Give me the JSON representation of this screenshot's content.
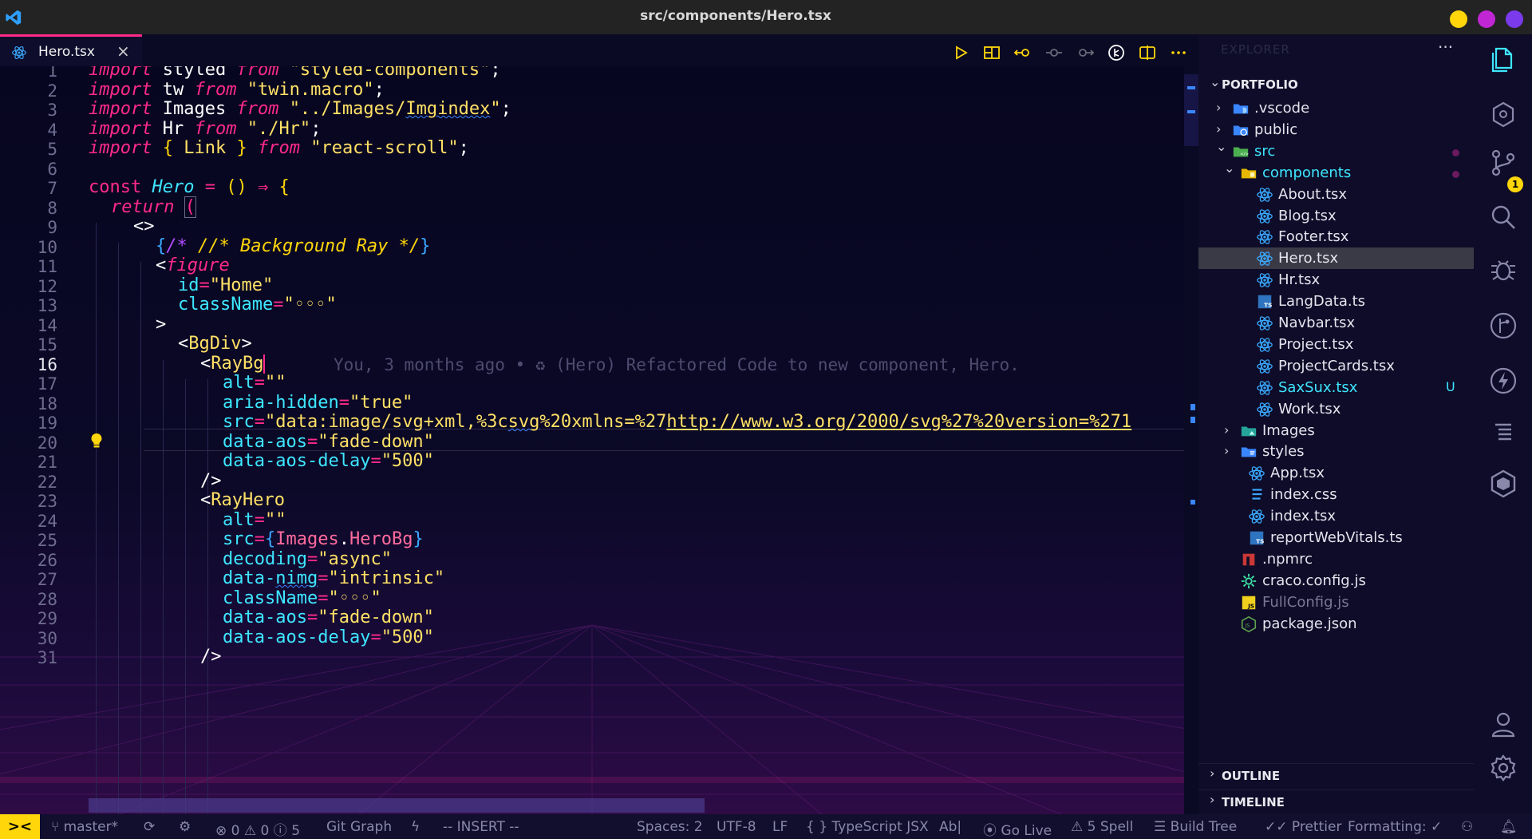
{
  "window": {
    "title": "src/components/Hero.tsx"
  },
  "tab": {
    "label": "Hero.tsx",
    "close_glyph": "×"
  },
  "colors": {
    "accent_pink": "#ff2a8a",
    "accent_yellow": "#ffd60a",
    "accent_cyan": "#3ee6ff",
    "window_yellow": "#ffd60a",
    "window_magenta": "#c026d3",
    "window_purple": "#7c3aed"
  },
  "toolbar": {
    "icons": [
      "run-icon",
      "split-layout-icon",
      "go-back-icon",
      "commit-icon",
      "go-forward-icon",
      "timeline-icon",
      "split-editor-icon",
      "more-actions-icon"
    ]
  },
  "editor": {
    "active_line": 16,
    "ghost_text": "You, 3 months ago • ♻ (Hero) Refactored Code to new component, Hero.",
    "lines": [
      {
        "n": "1"
      },
      {
        "n": "2"
      },
      {
        "n": "3"
      },
      {
        "n": "4"
      },
      {
        "n": "5"
      },
      {
        "n": "6"
      },
      {
        "n": "7"
      },
      {
        "n": "8"
      },
      {
        "n": "9"
      },
      {
        "n": "10"
      },
      {
        "n": "11"
      },
      {
        "n": "12"
      },
      {
        "n": "13"
      },
      {
        "n": "14"
      },
      {
        "n": "15"
      },
      {
        "n": "16"
      },
      {
        "n": "17"
      },
      {
        "n": "18"
      },
      {
        "n": "19"
      },
      {
        "n": "20"
      },
      {
        "n": "21"
      },
      {
        "n": "22"
      },
      {
        "n": "23"
      },
      {
        "n": "24"
      },
      {
        "n": "25"
      },
      {
        "n": "26"
      },
      {
        "n": "27"
      },
      {
        "n": "28"
      },
      {
        "n": "29"
      },
      {
        "n": "30"
      },
      {
        "n": "31"
      }
    ],
    "tokens": {
      "l1": [
        "import",
        " styled ",
        "from",
        " ",
        "\"styled-components\"",
        ";"
      ],
      "l2": [
        "import",
        " tw ",
        "from",
        " ",
        "\"twin.macro\"",
        ";"
      ],
      "l3": [
        "import",
        " Images ",
        "from",
        " ",
        "\"../Images/",
        "Imgindex",
        "\"",
        ";"
      ],
      "l4": [
        "import",
        " Hr ",
        "from",
        " ",
        "\"./Hr\"",
        ";"
      ],
      "l5": [
        "import",
        " ",
        "{",
        " Link ",
        "}",
        " ",
        "from",
        " ",
        "\"react-scroll\"",
        ";"
      ],
      "l7": [
        "const",
        " ",
        "Hero",
        " ",
        "=",
        " ",
        "()",
        " ",
        "⇒",
        " ",
        "{"
      ],
      "l8": [
        "return",
        " ",
        "("
      ],
      "l9": [
        "<>"
      ],
      "l10": [
        "{",
        "/*",
        " //* Background Ray */",
        "}"
      ],
      "l11": [
        "<",
        "figure"
      ],
      "l12": [
        "id",
        "=",
        "\"Home\""
      ],
      "l13": [
        "className",
        "=",
        "\"◦◦◦\""
      ],
      "l14": [
        ">"
      ],
      "l15": [
        "<",
        "BgDiv",
        ">"
      ],
      "l16": [
        "<",
        "RayBg"
      ],
      "l17": [
        "alt",
        "=",
        "\"\""
      ],
      "l18": [
        "aria-hidden",
        "=",
        "\"true\""
      ],
      "l19": [
        "src",
        "=",
        "\"data:image/",
        "svg+xml,%3c",
        "svg",
        "%20xmlns=%27",
        "http://www.w3.org/2000/svg%27%20version=%271"
      ],
      "l20": [
        "data-aos",
        "=",
        "\"fade-down\""
      ],
      "l21": [
        "data-aos-delay",
        "=",
        "\"500\""
      ],
      "l22": [
        "/>"
      ],
      "l23": [
        "<",
        "RayHero"
      ],
      "l24": [
        "alt",
        "=",
        "\"\""
      ],
      "l25": [
        "src",
        "=",
        "{",
        "Images",
        ".",
        "HeroBg",
        "}"
      ],
      "l26": [
        "decoding",
        "=",
        "\"async\""
      ],
      "l27": [
        "data-",
        "nimg",
        "=",
        "\"intrinsic\""
      ],
      "l28": [
        "className",
        "=",
        "\"◦◦◦\""
      ],
      "l29": [
        "data-aos",
        "=",
        "\"fade-down\""
      ],
      "l30": [
        "data-aos-delay",
        "=",
        "\"500\""
      ],
      "l31": [
        "/>"
      ]
    }
  },
  "sidebar": {
    "title": "EXPLORER",
    "more": "···",
    "root": "PORTFOLIO",
    "tree": [
      {
        "label": ".vscode",
        "kind": "folder",
        "icon": "vscode-folder-icon",
        "depth": 1,
        "open": false
      },
      {
        "label": "public",
        "kind": "folder",
        "icon": "public-folder-icon",
        "depth": 1,
        "open": false
      },
      {
        "label": "src",
        "kind": "folder",
        "icon": "src-folder-icon",
        "depth": 1,
        "open": true,
        "modified": true
      },
      {
        "label": "components",
        "kind": "folder",
        "icon": "components-folder-icon",
        "depth": 2,
        "open": true,
        "modified": true
      },
      {
        "label": "About.tsx",
        "kind": "file",
        "icon": "react-icon",
        "depth": 3
      },
      {
        "label": "Blog.tsx",
        "kind": "file",
        "icon": "react-icon",
        "depth": 3
      },
      {
        "label": "Footer.tsx",
        "kind": "file",
        "icon": "react-icon",
        "depth": 3
      },
      {
        "label": "Hero.tsx",
        "kind": "file",
        "icon": "react-icon",
        "depth": 3,
        "selected": true
      },
      {
        "label": "Hr.tsx",
        "kind": "file",
        "icon": "react-icon",
        "depth": 3
      },
      {
        "label": "LangData.ts",
        "kind": "file",
        "icon": "typescript-icon",
        "depth": 3
      },
      {
        "label": "Navbar.tsx",
        "kind": "file",
        "icon": "react-icon",
        "depth": 3
      },
      {
        "label": "Project.tsx",
        "kind": "file",
        "icon": "react-icon",
        "depth": 3
      },
      {
        "label": "ProjectCards.tsx",
        "kind": "file",
        "icon": "react-icon",
        "depth": 3
      },
      {
        "label": "SaxSux.tsx",
        "kind": "file",
        "icon": "react-icon",
        "depth": 3,
        "untracked": true,
        "badge": "U"
      },
      {
        "label": "Work.tsx",
        "kind": "file",
        "icon": "react-icon",
        "depth": 3
      },
      {
        "label": "Images",
        "kind": "folder",
        "icon": "images-folder-icon",
        "depth": 2,
        "open": false
      },
      {
        "label": "styles",
        "kind": "folder",
        "icon": "styles-folder-icon",
        "depth": 2,
        "open": false
      },
      {
        "label": "App.tsx",
        "kind": "file",
        "icon": "react-icon",
        "depth": 2
      },
      {
        "label": "index.css",
        "kind": "file",
        "icon": "css-icon",
        "depth": 2
      },
      {
        "label": "index.tsx",
        "kind": "file",
        "icon": "react-icon",
        "depth": 2
      },
      {
        "label": "reportWebVitals.ts",
        "kind": "file",
        "icon": "typescript-icon",
        "depth": 2
      },
      {
        "label": ".npmrc",
        "kind": "file",
        "icon": "npm-icon",
        "depth": 1
      },
      {
        "label": "craco.config.js",
        "kind": "file",
        "icon": "config-gear-icon",
        "depth": 1
      },
      {
        "label": "FullConfig.js",
        "kind": "file",
        "icon": "javascript-icon",
        "depth": 1,
        "dimmed": true
      },
      {
        "label": "package.json",
        "kind": "file",
        "icon": "nodejs-icon",
        "depth": 1
      }
    ],
    "outline": "OUTLINE",
    "timeline": "TIMELINE"
  },
  "activity_bar": {
    "items": [
      "explorer-icon",
      "extensions-icon",
      "source-control-icon",
      "search-icon",
      "debug-icon",
      "git-graph-icon",
      "lightning-icon",
      "outline-list-icon",
      "cubes-icon",
      "account-icon",
      "settings-gear-icon"
    ],
    "scm_badge": "1"
  },
  "statusbar": {
    "remote": "><",
    "branch": "master*",
    "errors": "0",
    "warnings": "0",
    "info": "5",
    "git_graph": "Git Graph",
    "mode": "-- INSERT --",
    "spaces": "Spaces: 2",
    "encoding": "UTF-8",
    "eol": "LF",
    "language": "TypeScript JSX",
    "ab": "Ab|",
    "go_live": "Go Live",
    "spell": "5 Spell",
    "build_tree": "Build Tree",
    "prettier": "Prettier",
    "formatting": "Formatting: ✓"
  }
}
